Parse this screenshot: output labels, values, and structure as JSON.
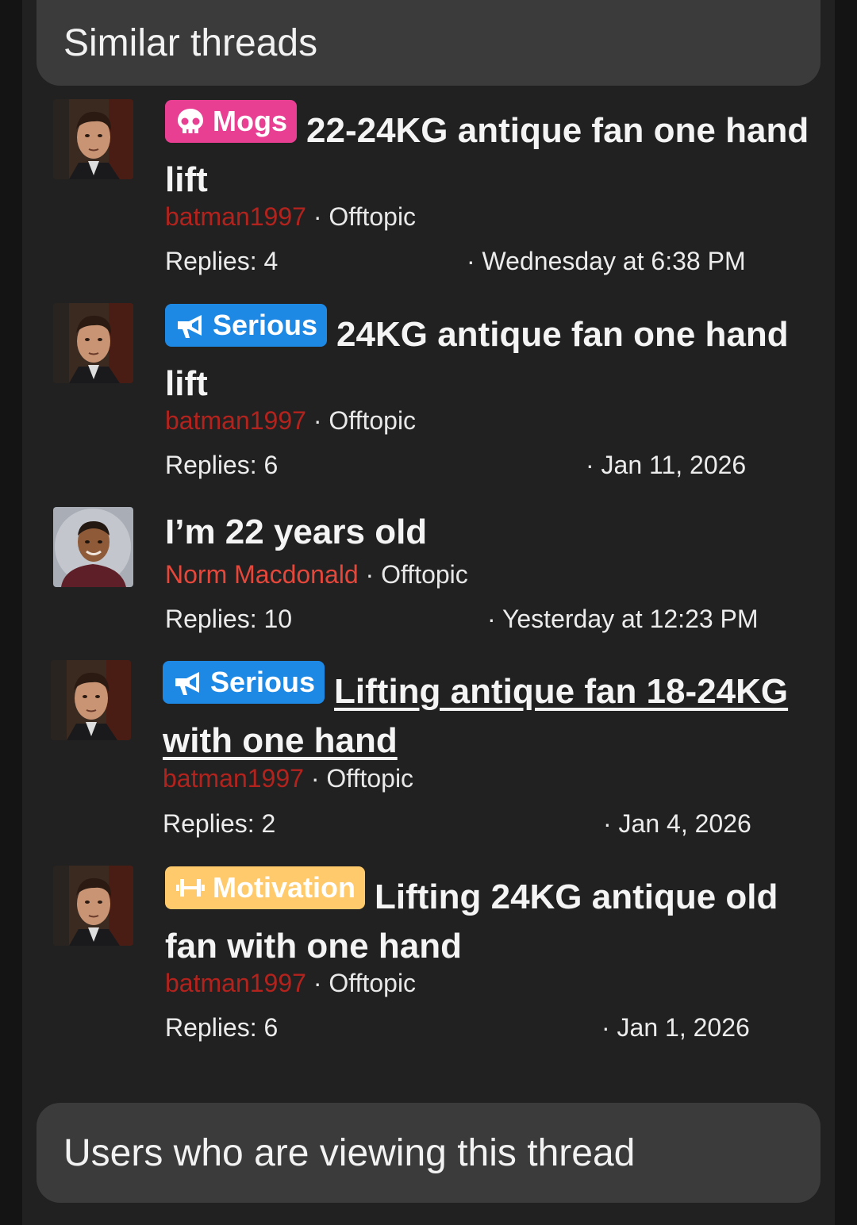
{
  "similar_threads_heading": "Similar threads",
  "viewers_heading": "Users who are viewing this thread",
  "separator": "·",
  "threads": [
    {
      "label": "Mogs",
      "label_icon": "skull-icon",
      "title": "22-24KG antique fan one hand lift",
      "author": "batman1997",
      "forum": "Offtopic",
      "replies": "Replies: 4",
      "date": "· Wednesday at 6:38 PM"
    },
    {
      "label": "Serious",
      "label_icon": "megaphone-icon",
      "title": "24KG antique fan one hand lift",
      "author": "batman1997",
      "forum": "Offtopic",
      "replies": "Replies: 6",
      "date": "· Jan 11, 2026"
    },
    {
      "label": "",
      "title": "I’m 22 years old",
      "author": "Norm Macdonald",
      "forum": "Offtopic",
      "replies": "Replies: 10",
      "date": "· Yesterday at 12:23 PM"
    },
    {
      "label": "Serious",
      "label_icon": "megaphone-icon",
      "title": "Lifting antique fan 18-24KG with one hand",
      "author": "batman1997",
      "forum": "Offtopic",
      "replies": "Replies: 2",
      "date": "· Jan 4, 2026"
    },
    {
      "label": "Motivation",
      "label_icon": "dumbbell-icon",
      "title": "Lifting 24KG antique old fan with one hand",
      "author": "batman1997",
      "forum": "Offtopic",
      "replies": "Replies: 6",
      "date": "· Jan 1, 2026"
    }
  ],
  "colors": {
    "mogs_label": "#e93f93",
    "serious_label": "#1e88e5",
    "motivation_label": "#ffca6b",
    "author_batman": "#b3231e",
    "author_norm": "#e5473b"
  }
}
